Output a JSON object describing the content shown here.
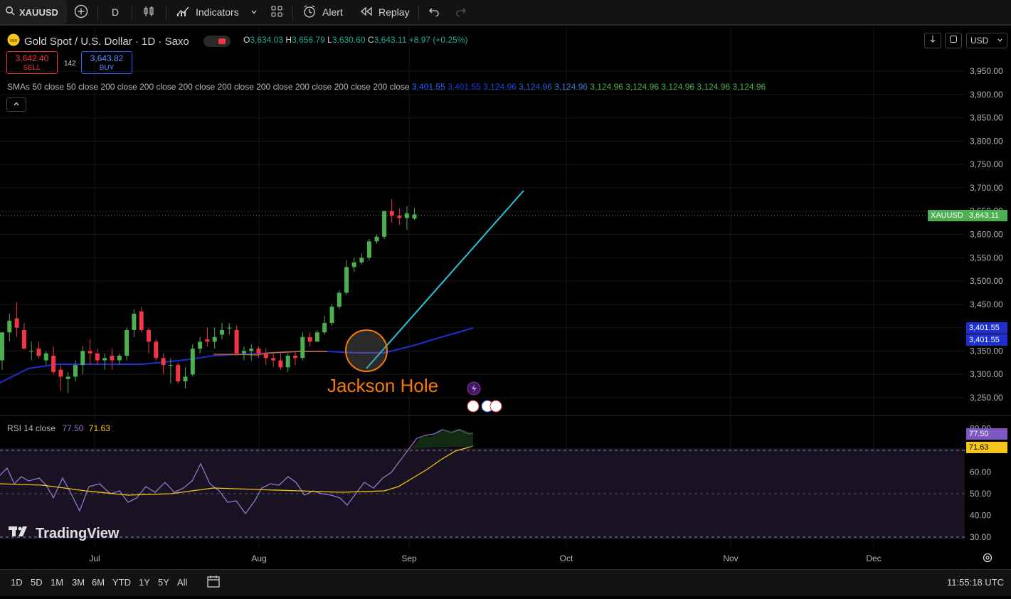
{
  "toolbar": {
    "symbol": "XAUUSD",
    "interval": "D",
    "indicators": "Indicators",
    "alert": "Alert",
    "replay": "Replay"
  },
  "legend": {
    "title": "Gold Spot / U.S. Dollar · 1D · Saxo",
    "o_label": "O",
    "o": "3,634.03",
    "h_label": "H",
    "h": "3,656.79",
    "l_label": "L",
    "l": "3,630.60",
    "c_label": "C",
    "c": "3,643.11",
    "chg": "+8.97 (+0.25%)"
  },
  "trade": {
    "sell_price": "3,642.40",
    "sell_label": "SELL",
    "spread": "142",
    "buy_price": "3,643.82",
    "buy_label": "BUY"
  },
  "smas": {
    "label": "SMAs 50 close 50 close 200 close 200 close 200 close 200 close 200 close 200 close 200 close 200 close",
    "values": [
      "3,401.55",
      "3,401.55",
      "3,124.96",
      "3,124.96",
      "3,124.96",
      "3,124.96",
      "3,124.96",
      "3,124.96",
      "3,124.96",
      "3,124.96"
    ],
    "colors": [
      "#2962ff",
      "#1e3ad6",
      "#1848e0",
      "#2a5cc8",
      "#3a7bd5",
      "#4caf50",
      "#4caf50",
      "#4caf50",
      "#4caf50",
      "#4caf50"
    ]
  },
  "collapse_icon": "chevron-up-icon",
  "rsi": {
    "label": "RSI 14 close",
    "v1": "77.50",
    "v2": "71.63",
    "color1": "#9575cd",
    "color2": "#f5c518"
  },
  "price_axis": {
    "ticks": [
      "3,950.00",
      "3,900.00",
      "3,850.00",
      "3,800.00",
      "3,750.00",
      "3,700.00",
      "3,650.00",
      "3,600.00",
      "3,550.00",
      "3,500.00",
      "3,450.00",
      "3,400.00",
      "3,350.00",
      "3,300.00",
      "3,250.00"
    ],
    "rsi_ticks": [
      "80.00",
      "60.00",
      "50.00",
      "40.00",
      "30.00"
    ]
  },
  "tags": {
    "symbol": "XAUUSD",
    "last": "3,643.11",
    "sma1": "3,401.55",
    "sma2": "3,401.55",
    "rsi1": "77.50",
    "rsi2": "71.63"
  },
  "time_axis": [
    "Jul",
    "Aug",
    "Sep",
    "Oct",
    "Nov",
    "Dec"
  ],
  "annotation": "Jackson Hole",
  "watermark": "TradingView",
  "currency": "USD",
  "ranges": [
    "1D",
    "5D",
    "1M",
    "3M",
    "6M",
    "YTD",
    "1Y",
    "5Y",
    "All"
  ],
  "clock": "11:55:18 UTC",
  "colors": {
    "up": "#4caf50",
    "down": "#f23645",
    "sma50": "#1e2fd0",
    "sma200": "#f57c00",
    "trend": "#26c6da",
    "rsi": "#9575cd",
    "rsi_ma": "#f5c518",
    "annotation": "#f57c00"
  },
  "chart_data": {
    "type": "candlestick",
    "ylim": [
      3230,
      3970
    ],
    "x": [
      "Jun 26",
      "Jun 27",
      "Jun 30",
      "Jul 1",
      "Jul 2",
      "Jul 3",
      "Jul 4",
      "Jul 7",
      "Jul 8",
      "Jul 9",
      "Jul 10",
      "Jul 11",
      "Jul 14",
      "Jul 15",
      "Jul 16",
      "Jul 17",
      "Jul 18",
      "Jul 21",
      "Jul 22",
      "Jul 23",
      "Jul 24",
      "Jul 25",
      "Jul 28",
      "Jul 29",
      "Jul 30",
      "Jul 31",
      "Aug 1",
      "Aug 4",
      "Aug 5",
      "Aug 6",
      "Aug 7",
      "Aug 8",
      "Aug 11",
      "Aug 12",
      "Aug 13",
      "Aug 14",
      "Aug 15",
      "Aug 18",
      "Aug 19",
      "Aug 20",
      "Aug 21",
      "Aug 22",
      "Aug 25",
      "Aug 26",
      "Aug 27",
      "Aug 28",
      "Aug 29",
      "Sep 1",
      "Sep 2",
      "Sep 3",
      "Sep 4",
      "Sep 5",
      "Sep 8",
      "Sep 9",
      "Sep 10",
      "Sep 11",
      "Sep 12"
    ],
    "open": [
      3330,
      3390,
      3420,
      3395,
      3350,
      3355,
      3330,
      3340,
      3310,
      3290,
      3295,
      3320,
      3350,
      3345,
      3330,
      3340,
      3330,
      3340,
      3395,
      3435,
      3395,
      3370,
      3335,
      3320,
      3320,
      3285,
      3300,
      3355,
      3375,
      3370,
      3385,
      3400,
      3395,
      3345,
      3350,
      3355,
      3345,
      3335,
      3330,
      3315,
      3340,
      3335,
      3380,
      3370,
      3390,
      3410,
      3445,
      3475,
      3530,
      3540,
      3550,
      3585,
      3595,
      3650,
      3640,
      3635,
      3634
    ],
    "high": [
      3350,
      3430,
      3455,
      3410,
      3370,
      3370,
      3350,
      3360,
      3320,
      3305,
      3330,
      3360,
      3375,
      3355,
      3345,
      3355,
      3345,
      3400,
      3440,
      3445,
      3400,
      3375,
      3345,
      3335,
      3325,
      3315,
      3365,
      3380,
      3400,
      3400,
      3410,
      3410,
      3405,
      3360,
      3365,
      3360,
      3355,
      3345,
      3345,
      3345,
      3350,
      3390,
      3390,
      3395,
      3425,
      3450,
      3480,
      3545,
      3550,
      3560,
      3590,
      3600,
      3650,
      3675,
      3655,
      3660,
      3657
    ],
    "low": [
      3310,
      3370,
      3380,
      3370,
      3330,
      3335,
      3320,
      3300,
      3265,
      3260,
      3285,
      3300,
      3320,
      3320,
      3310,
      3310,
      3320,
      3330,
      3380,
      3390,
      3345,
      3330,
      3300,
      3280,
      3280,
      3270,
      3295,
      3345,
      3360,
      3355,
      3375,
      3385,
      3340,
      3330,
      3330,
      3335,
      3320,
      3315,
      3310,
      3305,
      3320,
      3330,
      3360,
      3370,
      3385,
      3405,
      3440,
      3470,
      3520,
      3535,
      3545,
      3580,
      3590,
      3625,
      3620,
      3610,
      3631
    ],
    "close": [
      3390,
      3415,
      3400,
      3355,
      3350,
      3340,
      3345,
      3305,
      3295,
      3295,
      3320,
      3350,
      3345,
      3330,
      3335,
      3330,
      3340,
      3395,
      3430,
      3395,
      3370,
      3335,
      3320,
      3320,
      3285,
      3295,
      3355,
      3370,
      3370,
      3380,
      3395,
      3400,
      3345,
      3350,
      3355,
      3345,
      3335,
      3330,
      3315,
      3340,
      3335,
      3380,
      3370,
      3390,
      3410,
      3445,
      3475,
      3530,
      3540,
      3550,
      3585,
      3595,
      3650,
      3640,
      3635,
      3645,
      3643
    ]
  }
}
